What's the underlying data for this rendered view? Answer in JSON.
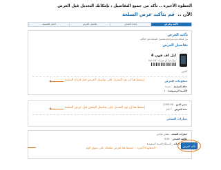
{
  "header": {
    "line1": "الخطوة الأخيرة .. تأكد من جميع التفاصيل ، بإمكانك التعديل قبل العرض",
    "line2_prefix": "الآن ..",
    "line2_action": "قم بتأكيد عرض السلعة"
  },
  "steps": [
    {
      "label": "اختيار التصنيف"
    },
    {
      "label": "تفاصيل العرض"
    },
    {
      "label": "إعداد الشحن"
    },
    {
      "label": "تأكيد وعرض"
    }
  ],
  "review": {
    "title": "تأكيد العرض",
    "note": "من فضلك قم بمراجعة تفاصيل السلعة قبل التأكيد",
    "details_title": "تفاصيل العرض",
    "product_title": "ابل اف فون 4",
    "product_subtitle": "جوال ابل اي فون 4 - 16 جيجا",
    "image_label": "الصور",
    "edit_link": "إضغط هنا إن تود التعديل على تفاصيل العرض قبل إدراج السلعة"
  },
  "pricing": {
    "title": "معلومات العرض",
    "rows": [
      {
        "key": "حالة السلعة",
        "value": "جديدة"
      },
      {
        "key": "الكمية المعروضة",
        "value": "1"
      },
      {
        "key": "سعر البيع",
        "value": "2,000.00"
      },
      {
        "key": "مدة العرض",
        "value": "7 أيام"
      }
    ]
  },
  "shipping": {
    "title": "خيارات الشحن",
    "rows": [
      {
        "key": "خيارات الشحن",
        "value": "شحن مجاني"
      },
      {
        "key": "تكلفة الشحن",
        "value": "0.00"
      },
      {
        "key": "عنوان البائع",
        "value": "المملكة العربية السعودية"
      }
    ],
    "edit_link": "إضغط هنا إن تود التعديل على تفاصيل الشحن قبل عرض السلعة"
  },
  "footer": {
    "hint": "الخطوة الأخيرة .. اضغط هنا لعرض سلعتك على سوق كوم",
    "confirm_label": "تأكيد العرض"
  },
  "colors": {
    "accent": "#1e6fb5",
    "highlight": "#e07b1f"
  }
}
